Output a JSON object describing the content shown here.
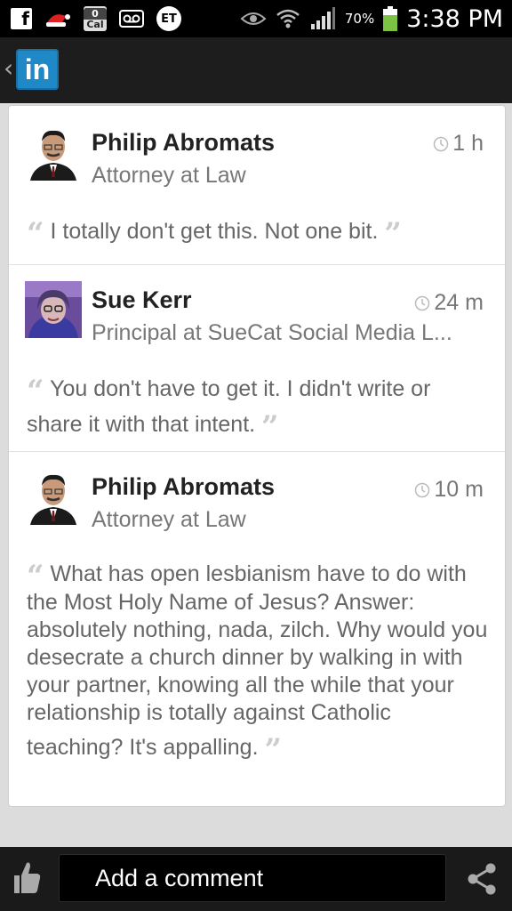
{
  "status_bar": {
    "facebook_icon": "f",
    "calendar_day": "0",
    "calendar_label": "Cal",
    "et_icon": "ET",
    "battery_percent": "70%",
    "battery_level": 0.7,
    "time": "3:38 PM"
  },
  "app_bar": {
    "back_icon": "‹",
    "logo_text": "in"
  },
  "comments": [
    {
      "name": "Philip Abromats",
      "title": "Attorney at Law",
      "time": "1 h",
      "text": "I totally don't get this.  Not one bit."
    },
    {
      "name": "Sue Kerr",
      "title": "Principal at SueCat Social Media L...",
      "time": "24 m",
      "text": "You don't have to get it. I didn't write or share it with that intent."
    },
    {
      "name": "Philip Abromats",
      "title": "Attorney at Law",
      "time": "10 m",
      "text": "What has open lesbianism have to do with the Most Holy Name of Jesus?  Answer: absolutely nothing, nada, zilch.  Why would you desecrate a church dinner by walking in with your partner, knowing all the while that your relationship is totally against Catholic teaching?  It's appalling."
    }
  ],
  "quote_open": "“",
  "quote_close": "”",
  "bottom_bar": {
    "comment_placeholder": "Add a comment"
  }
}
